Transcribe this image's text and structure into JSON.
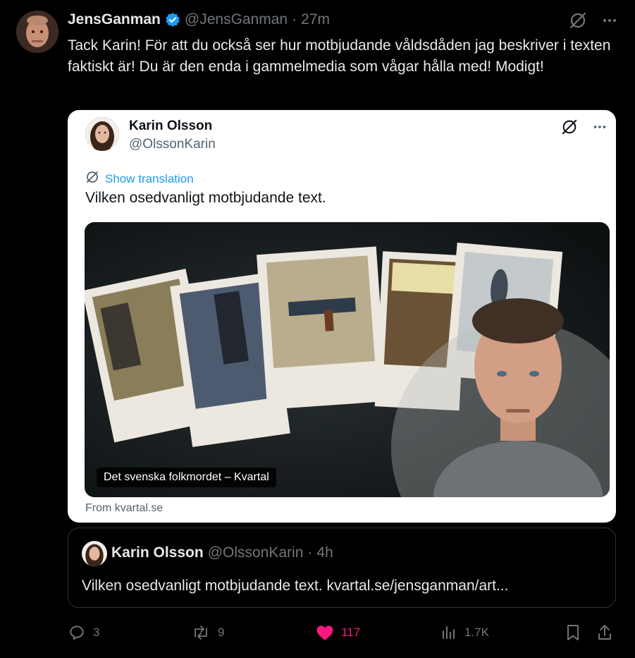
{
  "tweet": {
    "author_name": "JensGanman",
    "author_handle": "@JensGanman",
    "separator": "·",
    "time": "27m",
    "text": "Tack Karin! För att du också ser hur motbjudande våldsdåden jag beskriver i texten faktiskt är! Du är den enda i gammelmedia som vågar hålla med! Modigt!"
  },
  "embedded": {
    "author_name": "Karin Olsson",
    "author_handle": "@OlssonKarin",
    "translate_label": "Show translation",
    "text": "Vilken osedvanligt motbjudande text.",
    "media_caption": "Det svenska folkmordet – Kvartal",
    "source": "From kvartal.se"
  },
  "quote": {
    "author_name": "Karin Olsson",
    "author_handle": "@OlssonKarin",
    "separator": "·",
    "time": "4h",
    "text": "Vilken osedvanligt motbjudande text. kvartal.se/jensganman/art..."
  },
  "actions": {
    "replies": "3",
    "reposts": "9",
    "likes": "117",
    "views": "1.7K"
  },
  "colors": {
    "like": "#f91880",
    "link": "#1d9bf0",
    "verified": "#1d9bf0",
    "muted": "#71767b"
  },
  "icons": [
    "verified-badge-icon",
    "grok-icon",
    "more-icon",
    "translate-icon",
    "reply-icon",
    "repost-icon",
    "like-icon",
    "views-icon",
    "bookmark-icon",
    "share-icon"
  ]
}
